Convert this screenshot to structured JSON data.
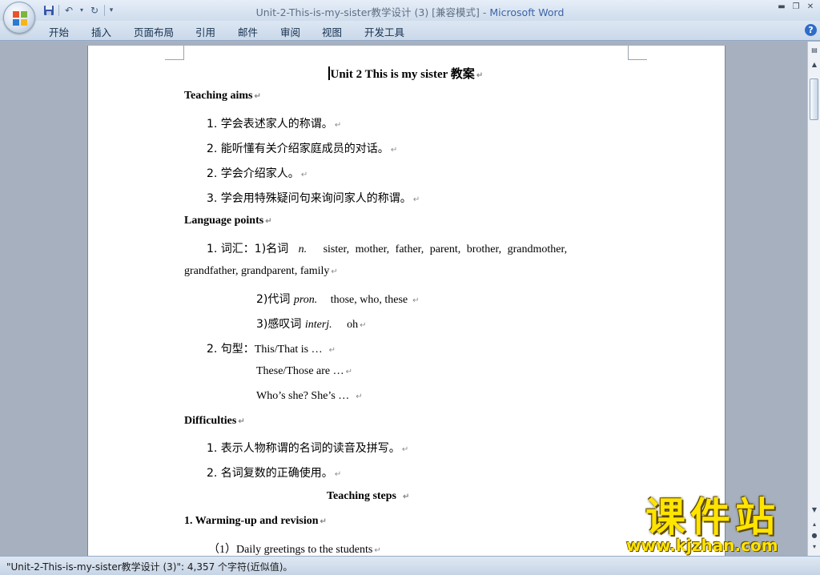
{
  "window": {
    "title": "Unit-2-This-is-my-sister教学设计 (3) [兼容模式] - ",
    "app_name": "Microsoft Word"
  },
  "quick_access": {
    "save_icon": "save-icon",
    "undo_icon": "undo-icon",
    "redo_icon": "redo-icon",
    "customize_icon": "customize-qat-icon"
  },
  "ribbon_tabs": [
    "开始",
    "插入",
    "页面布局",
    "引用",
    "邮件",
    "审阅",
    "视图",
    "开发工具"
  ],
  "document": {
    "title": "Unit 2 This is my sister 教案",
    "teaching_aims": {
      "heading": "Teaching aims",
      "items": [
        "1. 学会表述家人的称谓。",
        "2. 能听懂有关介绍家庭成员的对话。",
        "2. 学会介绍家人。",
        "3. 学会用特殊疑问句来询问家人的称谓。"
      ]
    },
    "language_points": {
      "heading": "Language points",
      "vocab_prefix": "1. 词汇：1)名词",
      "vocab_pos": "n.",
      "vocab_nouns": "sister,  mother,  father,  parent,  brother,  grandmother,",
      "vocab_nouns_cont": "grandfather, grandparent, family",
      "pron_prefix": "2)代词",
      "pron_pos": "pron.",
      "pron_words": "those, who, these",
      "interj_prefix": "3)感叹词",
      "interj_pos": "interj.",
      "interj_words": "oh",
      "sentence_prefix": "2. 句型：",
      "sentence_1": "This/That  is  …",
      "sentence_2": "These/Those  are …",
      "sentence_3": "Who’s she? She’s …"
    },
    "difficulties": {
      "heading": "Difficulties",
      "items": [
        "1. 表示人物称谓的名词的读音及拼写。",
        "2. 名词复数的正确使用。"
      ]
    },
    "steps_heading": "Teaching steps",
    "warming_heading": "1. Warming-up  and revision",
    "greeting": "（1）Daily greetings to the students",
    "para_mark": "↵"
  },
  "status_bar": {
    "text": "\"Unit-2-This-is-my-sister教学设计 (3)\": 4,357 个字符(近似值)。"
  },
  "watermark": {
    "title": "课件站",
    "url": "www.kjzhan.com"
  },
  "colors": {
    "app_name": "#3a64a8",
    "watermark": "#ffe400"
  }
}
